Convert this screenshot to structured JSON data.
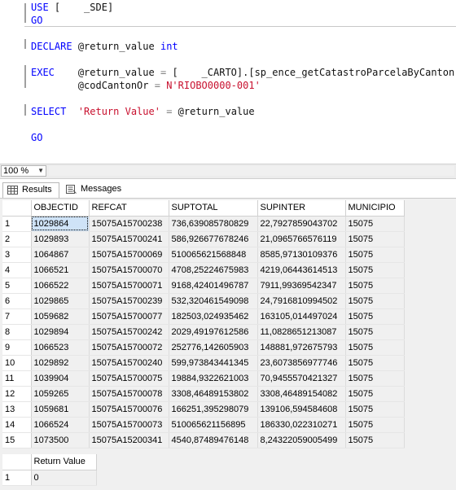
{
  "editor": {
    "use_kw": "USE",
    "use_db": "[    _SDE]",
    "go1": "GO",
    "declare_kw": "DECLARE",
    "declare_var": "@return_value",
    "declare_type": "int",
    "exec_kw": "EXEC",
    "exec_var": "@return_value",
    "exec_eq": "=",
    "exec_proc": "[    _CARTO].[sp_ence_getCatastroParcelaByCanton]",
    "param_name": "@codCantonOr",
    "param_eq": "=",
    "param_value": "N'RIOBO0000-001'",
    "select_kw": "SELECT",
    "select_alias": "'Return Value'",
    "select_eq": "=",
    "select_var": "@return_value",
    "go2": "GO"
  },
  "zoom": {
    "value": "100 %"
  },
  "tabs": [
    {
      "label": "Results",
      "icon": "grid-icon"
    },
    {
      "label": "Messages",
      "icon": "messages-icon"
    }
  ],
  "results": {
    "columns": [
      "OBJECTID",
      "REFCAT",
      "SUPTOTAL",
      "SUPINTER",
      "MUNICIPIO"
    ],
    "rows": [
      [
        "1",
        "1029864",
        "15075A15700238",
        "736,639085780829",
        "22,7927859043702",
        "15075"
      ],
      [
        "2",
        "1029893",
        "15075A15700241",
        "586,926677678246",
        "21,0965766576119",
        "15075"
      ],
      [
        "3",
        "1064867",
        "15075A15700069",
        "510065621568848",
        "8585,97130109376",
        "15075"
      ],
      [
        "4",
        "1066521",
        "15075A15700070",
        "4708,25224675983",
        "4219,06443614513",
        "15075"
      ],
      [
        "5",
        "1066522",
        "15075A15700071",
        "9168,42401496787",
        "7911,99369542347",
        "15075"
      ],
      [
        "6",
        "1029865",
        "15075A15700239",
        "532,320461549098",
        "24,7916810994502",
        "15075"
      ],
      [
        "7",
        "1059682",
        "15075A15700077",
        "182503,024935462",
        "163105,014497024",
        "15075"
      ],
      [
        "8",
        "1029894",
        "15075A15700242",
        "2029,49197612586",
        "11,0828651213087",
        "15075"
      ],
      [
        "9",
        "1066523",
        "15075A15700072",
        "252776,142605903",
        "148881,972675793",
        "15075"
      ],
      [
        "10",
        "1029892",
        "15075A15700240",
        "599,973843441345",
        "23,6073856977746",
        "15075"
      ],
      [
        "11",
        "1039904",
        "15075A15700075",
        "19884,9322621003",
        "70,9455570421327",
        "15075"
      ],
      [
        "12",
        "1059265",
        "15075A15700078",
        "3308,46489153802",
        "3308,46489154082",
        "15075"
      ],
      [
        "13",
        "1059681",
        "15075A15700076",
        "166251,395298079",
        "139106,594584608",
        "15075"
      ],
      [
        "14",
        "1066524",
        "15075A15700073",
        "510065621156895",
        "186330,022310271",
        "15075"
      ],
      [
        "15",
        "1073500",
        "15075A15200341",
        "4540,87489476148",
        "8,24322059005499",
        "15075"
      ]
    ]
  },
  "return_grid": {
    "column": "Return Value",
    "rows": [
      [
        "1",
        "0"
      ]
    ]
  }
}
